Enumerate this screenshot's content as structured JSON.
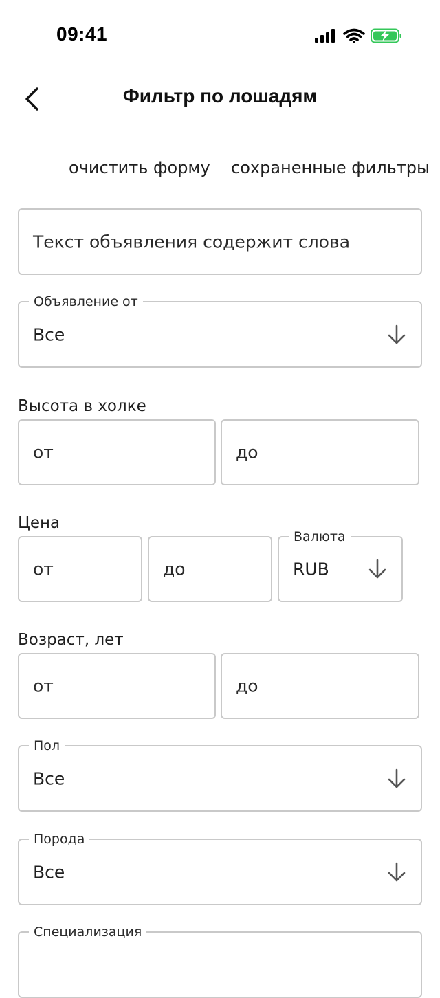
{
  "status_bar": {
    "time": "09:41"
  },
  "header": {
    "title": "Фильтр по лошадям",
    "back_icon": "chevron-left-icon"
  },
  "actions": {
    "clear_label": "очистить форму",
    "saved_label": "сохраненные фильтры"
  },
  "text_search": {
    "placeholder": "Текст объявления содержит слова"
  },
  "ad_from": {
    "label": "Объявление от",
    "value": "Все"
  },
  "height": {
    "label": "Высота в холке",
    "from_placeholder": "от",
    "to_placeholder": "до"
  },
  "price": {
    "label": "Цена",
    "from_placeholder": "от",
    "to_placeholder": "до",
    "currency_label": "Валюта",
    "currency_value": "RUB"
  },
  "age": {
    "label": "Возраст, лет",
    "from_placeholder": "от",
    "to_placeholder": "до"
  },
  "sex": {
    "label": "Пол",
    "value": "Все"
  },
  "breed": {
    "label": "Порода",
    "value": "Все"
  },
  "specialization": {
    "label": "Специализация"
  },
  "colors": {
    "battery": "#34c759",
    "border": "#c9c9c9",
    "text": "#1f1f1f"
  }
}
